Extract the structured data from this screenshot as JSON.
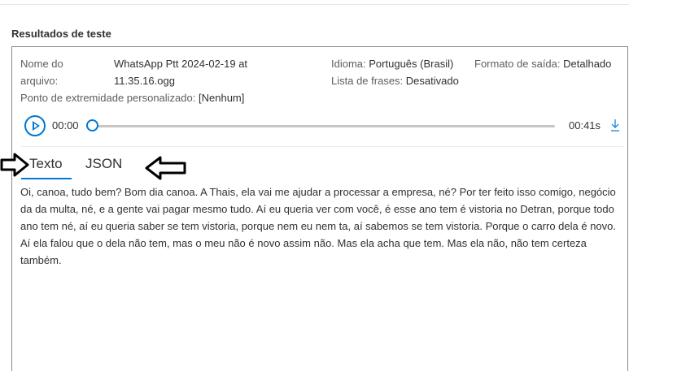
{
  "section_title": "Resultados de teste",
  "file": {
    "name_label_line1": "Nome do",
    "name_label_line2": "arquivo:",
    "name_value_line1": "WhatsApp Ptt 2024-02-19 at",
    "name_value_line2": "11.35.16.ogg",
    "endpoint_label": "Ponto de extremidade personalizado:",
    "endpoint_value": "[Nenhum]",
    "language_label": "Idioma:",
    "language_value": "Português (Brasil)",
    "phrase_list_label": "Lista de frases:",
    "phrase_list_value": "Desativado",
    "output_format_label": "Formato de saída:",
    "output_format_value": "Detalhado"
  },
  "player": {
    "current_time": "00:00",
    "duration": "00:41s",
    "progress": 0
  },
  "tabs": [
    {
      "label": "Texto",
      "selected": true
    },
    {
      "label": "JSON",
      "selected": false
    }
  ],
  "transcript": "Oi, canoa, tudo bem? Bom dia canoa. A Thais, ela vai me ajudar a processar a empresa, né? Por ter feito isso comigo, negócio da da multa, né, e a gente vai pagar mesmo tudo. Aí eu queria ver com você, é esse ano tem é vistoria no Detran, porque todo ano tem né, aí eu queria saber se tem vistoria, porque nem eu nem ta, aí sabemos se tem vistoria. Porque o carro dela é novo. Aí ela falou que o dela não tem, mas o meu não é novo assim não. Mas ela acha que tem. Mas ela não, não tem certeza também.",
  "icons": {
    "play": "play-icon",
    "download": "download-icon",
    "annotation_arrows": "arrow-right-icon"
  },
  "colors": {
    "accent": "#0078d4"
  }
}
